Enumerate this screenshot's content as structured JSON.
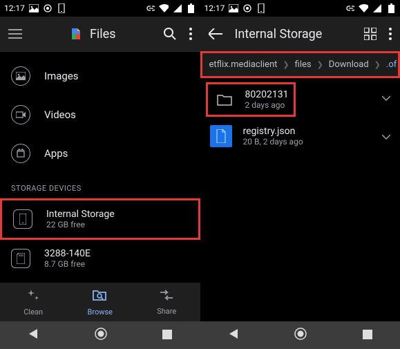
{
  "left": {
    "status": {
      "time": "12:17"
    },
    "app": {
      "title": "Files"
    },
    "categories": [
      {
        "label": "Images"
      },
      {
        "label": "Videos"
      },
      {
        "label": "Apps"
      }
    ],
    "section_header": "STORAGE DEVICES",
    "storage": [
      {
        "title": "Internal Storage",
        "sub": "22 GB free"
      },
      {
        "title": "3288-140E",
        "sub": "8.7 GB free"
      }
    ],
    "nav": {
      "clean": "Clean",
      "browse": "Browse",
      "share": "Share"
    }
  },
  "right": {
    "status": {
      "time": "12:17"
    },
    "app": {
      "title": "Internal Storage"
    },
    "breadcrumb": [
      "etflix.mediaclient",
      "files",
      "Download",
      ".of"
    ],
    "files": [
      {
        "name": "80202131",
        "meta": "2 days ago",
        "type": "folder"
      },
      {
        "name": "registry.json",
        "meta": "20 B, 2 days ago",
        "type": "file"
      }
    ]
  }
}
